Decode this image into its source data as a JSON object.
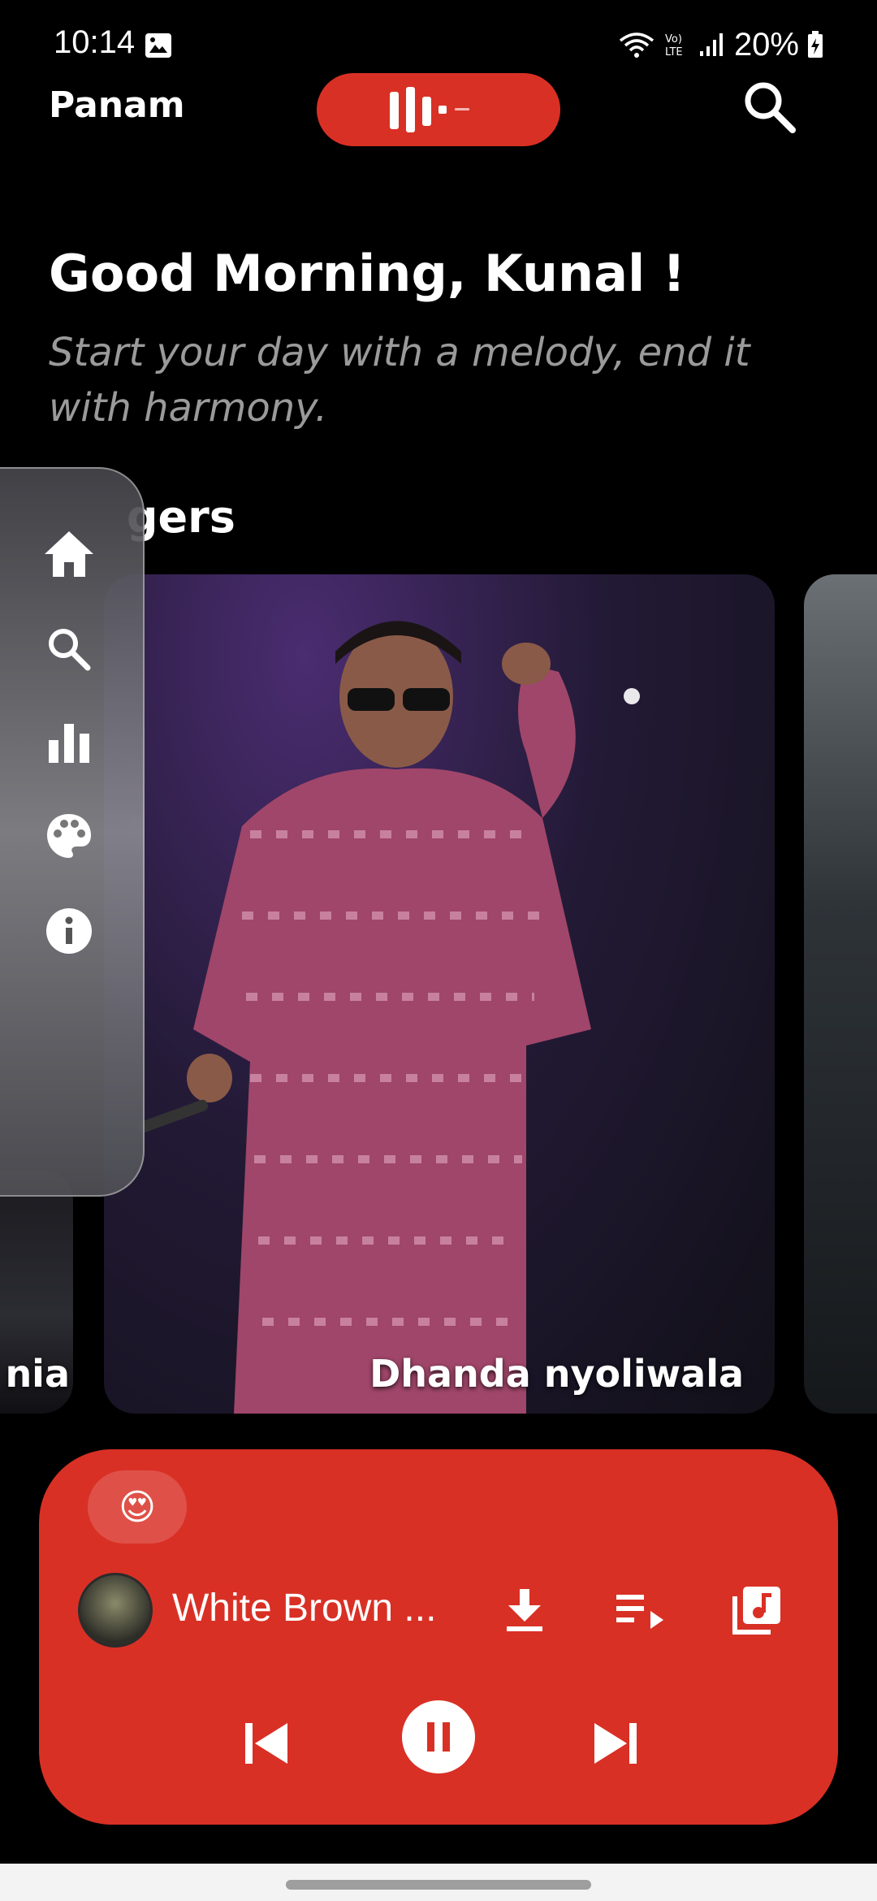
{
  "status_bar": {
    "time": "10:14",
    "battery": "20%"
  },
  "header": {
    "app_name": "Panam",
    "logo_icon": "audio-wave-logo",
    "search_icon": "search-icon"
  },
  "greeting": {
    "title": "Good Morning, Kunal !",
    "subtitle": "Start your day with a melody, end it with harmony."
  },
  "section": {
    "title_visible": "gers"
  },
  "singers": [
    {
      "name": "nia"
    },
    {
      "name": "Dhanda nyoliwala"
    },
    {
      "name": ""
    }
  ],
  "side_nav": {
    "items": [
      {
        "icon": "home-icon"
      },
      {
        "icon": "search-icon"
      },
      {
        "icon": "bar-chart-icon"
      },
      {
        "icon": "palette-icon"
      },
      {
        "icon": "info-icon"
      }
    ]
  },
  "player": {
    "emoji": "😍",
    "track_title": "White Brown ...",
    "accent_color": "#d93025"
  }
}
